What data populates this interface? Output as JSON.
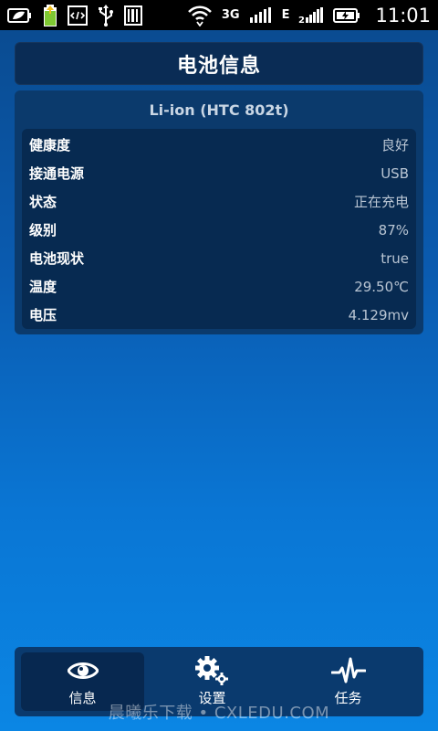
{
  "status_bar": {
    "icons_left": [
      "leaf-battery-icon",
      "battery-charging-icon",
      "code-icon",
      "usb-icon",
      "barcode-icon"
    ],
    "network_type": "3G",
    "data_type": "E",
    "time": "11:01"
  },
  "header": {
    "title": "电池信息"
  },
  "battery": {
    "model": "Li-ion (HTC 802t)",
    "rows": [
      {
        "label": "健康度",
        "value": "良好"
      },
      {
        "label": "接通电源",
        "value": "USB"
      },
      {
        "label": "状态",
        "value": "正在充电"
      },
      {
        "label": "级别",
        "value": "87%"
      },
      {
        "label": "电池现状",
        "value": "true"
      },
      {
        "label": "温度",
        "value": "29.50℃"
      },
      {
        "label": "电压",
        "value": "4.129mv"
      }
    ]
  },
  "nav": {
    "items": [
      {
        "label": "信息",
        "icon": "eye-icon",
        "active": true
      },
      {
        "label": "设置",
        "icon": "gear-icon",
        "active": false
      },
      {
        "label": "任务",
        "icon": "pulse-icon",
        "active": false
      }
    ]
  },
  "watermark": "晨曦乐下载 • CXLEDU.COM"
}
